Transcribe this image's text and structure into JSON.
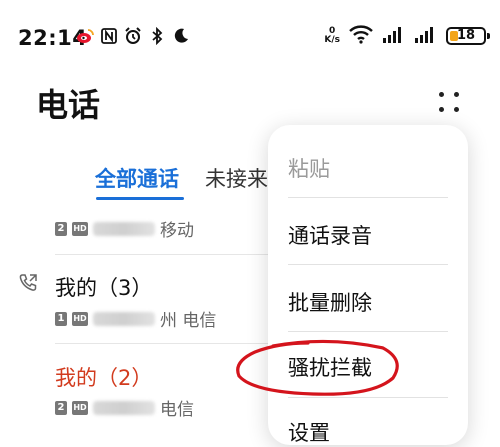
{
  "status_bar": {
    "time": "22:14",
    "left_icons": [
      "weibo-icon",
      "nfc-icon",
      "alarm-icon",
      "bluetooth-icon",
      "moon-icon"
    ],
    "net_speed_value": "0",
    "net_speed_unit": "K/s",
    "battery_level": "18",
    "battery_color": "#f3a51a"
  },
  "header": {
    "title": "电话"
  },
  "tabs": [
    {
      "label": "全部通话",
      "active": true
    },
    {
      "label": "未接来",
      "active": false
    }
  ],
  "calls": [
    {
      "sim": "2",
      "hd": "HD",
      "location_suffix": "移动"
    },
    {
      "name": "我的（3）",
      "sim": "1",
      "hd": "HD",
      "location_suffix": "州 电信"
    },
    {
      "name": "我的（2）",
      "sim": "2",
      "hd": "HD",
      "location_suffix": "电信"
    }
  ],
  "menu": {
    "items": [
      {
        "label": "粘贴",
        "enabled": false
      },
      {
        "label": "通话录音",
        "enabled": true
      },
      {
        "label": "批量删除",
        "enabled": true
      },
      {
        "label": "骚扰拦截",
        "enabled": true
      },
      {
        "label": "设置",
        "enabled": true
      }
    ]
  },
  "colors": {
    "accent": "#1a6fd8",
    "missed": "#d23b1e",
    "annotation": "#d4141c"
  }
}
